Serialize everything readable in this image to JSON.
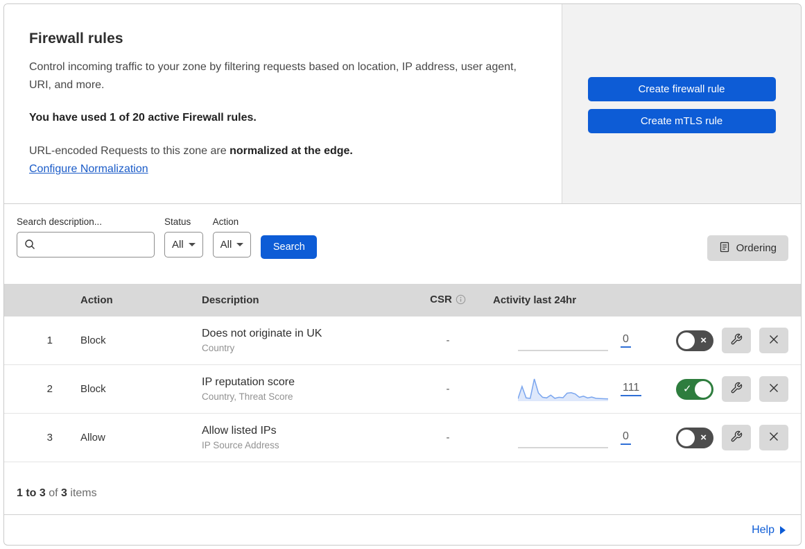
{
  "header": {
    "title": "Firewall rules",
    "description": "Control incoming traffic to your zone by filtering requests based on location, IP address, user agent, URI, and more.",
    "usage_line": "You have used 1 of 20 active Firewall rules.",
    "normalization_prefix": "URL-encoded Requests to this zone are ",
    "normalization_bold": "normalized at the edge.",
    "normalization_link": "Configure Normalization",
    "buttons": [
      {
        "label": "Create firewall rule"
      },
      {
        "label": "Create mTLS rule"
      }
    ]
  },
  "filters": {
    "search_label": "Search description...",
    "search_value": "",
    "status_label": "Status",
    "status_value": "All",
    "action_label": "Action",
    "action_value": "All",
    "search_button_label": "Search",
    "ordering_button_label": "Ordering"
  },
  "table": {
    "columns": {
      "action": "Action",
      "description": "Description",
      "csr": "CSR",
      "activity": "Activity last 24hr"
    },
    "rows": [
      {
        "index": "1",
        "action": "Block",
        "description": "Does not originate in UK",
        "criteria": "Country",
        "csr": "-",
        "count": "0",
        "enabled": false,
        "sparkline": null
      },
      {
        "index": "2",
        "action": "Block",
        "description": "IP reputation score",
        "criteria": "Country, Threat Score",
        "csr": "-",
        "count": "111",
        "enabled": true,
        "sparkline": [
          8,
          65,
          12,
          10,
          100,
          35,
          15,
          12,
          25,
          10,
          15,
          13,
          34,
          36,
          30,
          15,
          20,
          12,
          16,
          10,
          9,
          8,
          7
        ]
      },
      {
        "index": "3",
        "action": "Allow",
        "description": "Allow listed IPs",
        "criteria": "IP Source Address",
        "csr": "-",
        "count": "0",
        "enabled": false,
        "sparkline": null
      }
    ]
  },
  "footer": {
    "range_bold": "1 to 3",
    "of_text": " of ",
    "total_bold": "3",
    "items_text": " items",
    "help_label": "Help"
  },
  "icons": {
    "toggle_off_cross": "×",
    "toggle_on_check": "✓"
  },
  "colors": {
    "accent_blue": "#0d5cd6",
    "link_blue": "#1a5bc8",
    "toggle_on_green": "#2e7d3e",
    "toggle_off_gray": "#4d4d4d",
    "table_header_gray": "#d9d9d9",
    "panel_gray": "#f2f2f2",
    "sparkline_stroke": "#7aa5ee",
    "sparkline_fill": "rgba(122,165,238,0.25)",
    "flat_line_gray": "#c9c9c9"
  }
}
